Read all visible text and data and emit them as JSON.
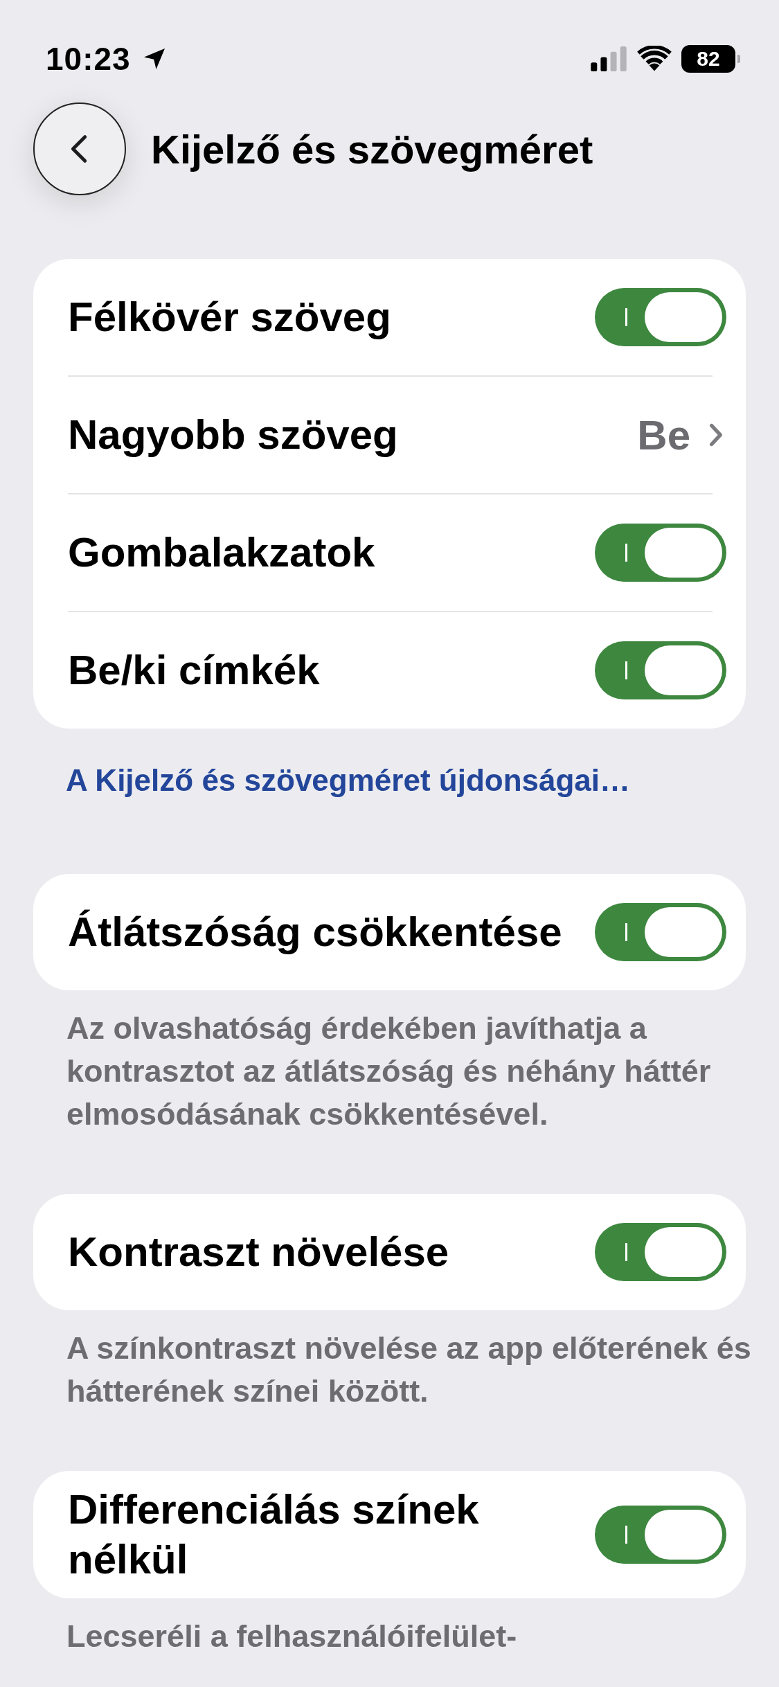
{
  "status_bar": {
    "time": "10:23",
    "battery": "82"
  },
  "header": {
    "title": "Kijelző és szövegméret"
  },
  "sections": [
    {
      "rows": [
        {
          "kind": "toggle",
          "label": "Félkövér szöveg",
          "on": true
        },
        {
          "kind": "value",
          "label": "Nagyobb szöveg",
          "value": "Be"
        },
        {
          "kind": "toggle",
          "label": "Gombalakzatok",
          "on": true
        },
        {
          "kind": "toggle",
          "label": "Be/ki címkék",
          "on": true
        }
      ],
      "link": "A Kijelző és szövegméret újdonságai…"
    },
    {
      "rows": [
        {
          "kind": "toggle",
          "label": "Átlátszóság csökkentése",
          "on": true
        }
      ],
      "footer": "Az olvashatóság érdekében javíthatja a kontrasztot az átlátszóság és néhány háttér elmosódásának csökkentésével."
    },
    {
      "rows": [
        {
          "kind": "toggle",
          "label": "Kontraszt növelése",
          "on": true
        }
      ],
      "footer": "A színkontraszt növelése az app előterének és hátterének színei között."
    },
    {
      "rows": [
        {
          "kind": "toggle",
          "label": "Differenciálás színek nélkül",
          "on": true
        }
      ],
      "footer": "Lecseréli a felhasználóifelület-"
    }
  ]
}
